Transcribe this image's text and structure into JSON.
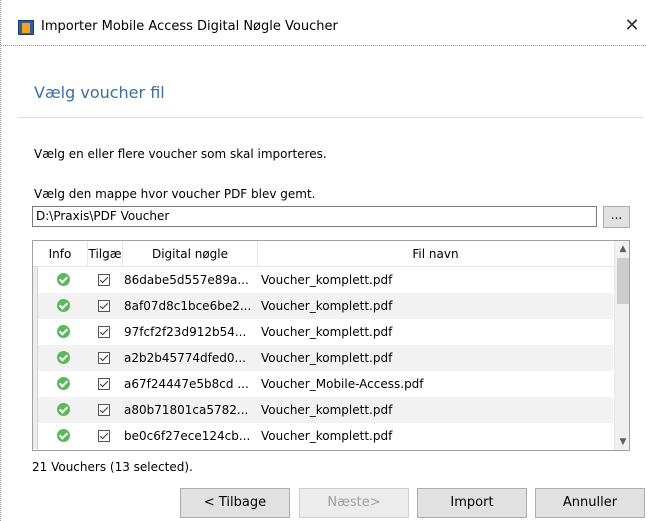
{
  "window": {
    "title": "Importer Mobile Access Digital Nøgle Voucher",
    "close_glyph": "✕"
  },
  "page": {
    "heading": "Vælg voucher fil",
    "description": "Vælg en eller flere voucher som skal importeres.",
    "folder_label": "Vælg den mappe hvor voucher PDF blev gemt.",
    "folder_path": "D:\\Praxis\\PDF Voucher",
    "browse_label": "..."
  },
  "grid": {
    "columns": [
      "Info",
      "Tilgæ",
      "Digital nøgle",
      "Fil navn"
    ],
    "rows": [
      {
        "info": "ok",
        "access": true,
        "key": "86dabe5d557e89a...",
        "file": "Voucher_komplett.pdf"
      },
      {
        "info": "ok",
        "access": true,
        "key": "8af07d8c1bce6be2...",
        "file": "Voucher_komplett.pdf"
      },
      {
        "info": "ok",
        "access": true,
        "key": "97fcf2f23d912b54...",
        "file": "Voucher_komplett.pdf"
      },
      {
        "info": "ok",
        "access": true,
        "key": "a2b2b45774dfed0...",
        "file": "Voucher_komplett.pdf"
      },
      {
        "info": "ok",
        "access": true,
        "key": "a67f24447e5b8cd ...",
        "file": "Voucher_Mobile-Access.pdf"
      },
      {
        "info": "ok",
        "access": true,
        "key": "a80b71801ca5782...",
        "file": "Voucher_komplett.pdf"
      },
      {
        "info": "ok",
        "access": true,
        "key": "be0c6f27ece124cb...",
        "file": "Voucher_komplett.pdf"
      }
    ],
    "scroll_up_glyph": "▲",
    "scroll_down_glyph": "▼"
  },
  "status": "21 Vouchers (13 selected).",
  "buttons": {
    "back": "< Tilbage",
    "next": "Næste>",
    "import": "Import",
    "cancel": "Annuller"
  }
}
